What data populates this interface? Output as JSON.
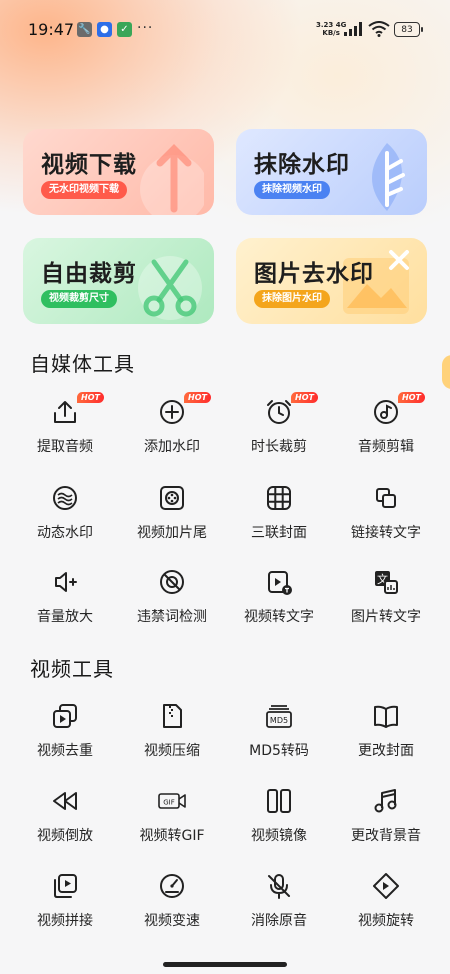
{
  "status_bar": {
    "time": "19:47",
    "network_speed_value": "3.23",
    "network_speed_unit": "KB/s",
    "network_type": "4G",
    "battery": "83",
    "overflow_indicator": "···"
  },
  "feature_cards": [
    {
      "title": "视频下载",
      "badge": "无水印视频下载",
      "icon": "download-arrow-icon",
      "accent": "#ff5a4a"
    },
    {
      "title": "抹除水印",
      "badge": "抹除视频水印",
      "icon": "leaf-icon",
      "accent": "#4b82f2"
    },
    {
      "title": "自由裁剪",
      "badge": "视频裁剪尺寸",
      "icon": "scissors-icon",
      "accent": "#2fbf60"
    },
    {
      "title": "图片去水印",
      "badge": "抹除图片水印",
      "icon": "image-close-icon",
      "accent": "#f4a51c"
    }
  ],
  "sections": {
    "self_media": {
      "title": "自媒体工具",
      "tools": [
        {
          "label": "提取音频",
          "icon": "upload-icon",
          "hot": "HOT"
        },
        {
          "label": "添加水印",
          "icon": "add-watermark-icon",
          "hot": "HOT"
        },
        {
          "label": "时长裁剪",
          "icon": "alarm-clock-icon",
          "hot": "HOT"
        },
        {
          "label": "音频剪辑",
          "icon": "music-disc-icon",
          "hot": "HOT"
        },
        {
          "label": "动态水印",
          "icon": "waves-icon"
        },
        {
          "label": "视频加片尾",
          "icon": "film-reel-icon"
        },
        {
          "label": "三联封面",
          "icon": "grid-icon"
        },
        {
          "label": "链接转文字",
          "icon": "link-copy-icon"
        },
        {
          "label": "音量放大",
          "icon": "volume-up-icon"
        },
        {
          "label": "违禁词检测",
          "icon": "prohibit-icon"
        },
        {
          "label": "视频转文字",
          "icon": "video-to-text-icon"
        },
        {
          "label": "图片转文字",
          "icon": "image-to-text-icon"
        }
      ]
    },
    "video": {
      "title": "视频工具",
      "tools": [
        {
          "label": "视频去重",
          "icon": "video-duplicate-icon"
        },
        {
          "label": "视频压缩",
          "icon": "zip-file-icon"
        },
        {
          "label": "MD5转码",
          "icon": "md5-icon"
        },
        {
          "label": "更改封面",
          "icon": "book-icon"
        },
        {
          "label": "视频倒放",
          "icon": "rewind-icon"
        },
        {
          "label": "视频转GIF",
          "icon": "gif-icon"
        },
        {
          "label": "视频镜像",
          "icon": "mirror-icon"
        },
        {
          "label": "更改背景音",
          "icon": "music-note-icon"
        },
        {
          "label": "视频拼接",
          "icon": "video-join-icon"
        },
        {
          "label": "视频变速",
          "icon": "speedometer-icon"
        },
        {
          "label": "消除原音",
          "icon": "mic-off-icon"
        },
        {
          "label": "视频旋转",
          "icon": "rotate-icon"
        }
      ]
    }
  },
  "icon_text": {
    "md5": "MD5",
    "gif": "GIF",
    "image_text": "文"
  }
}
